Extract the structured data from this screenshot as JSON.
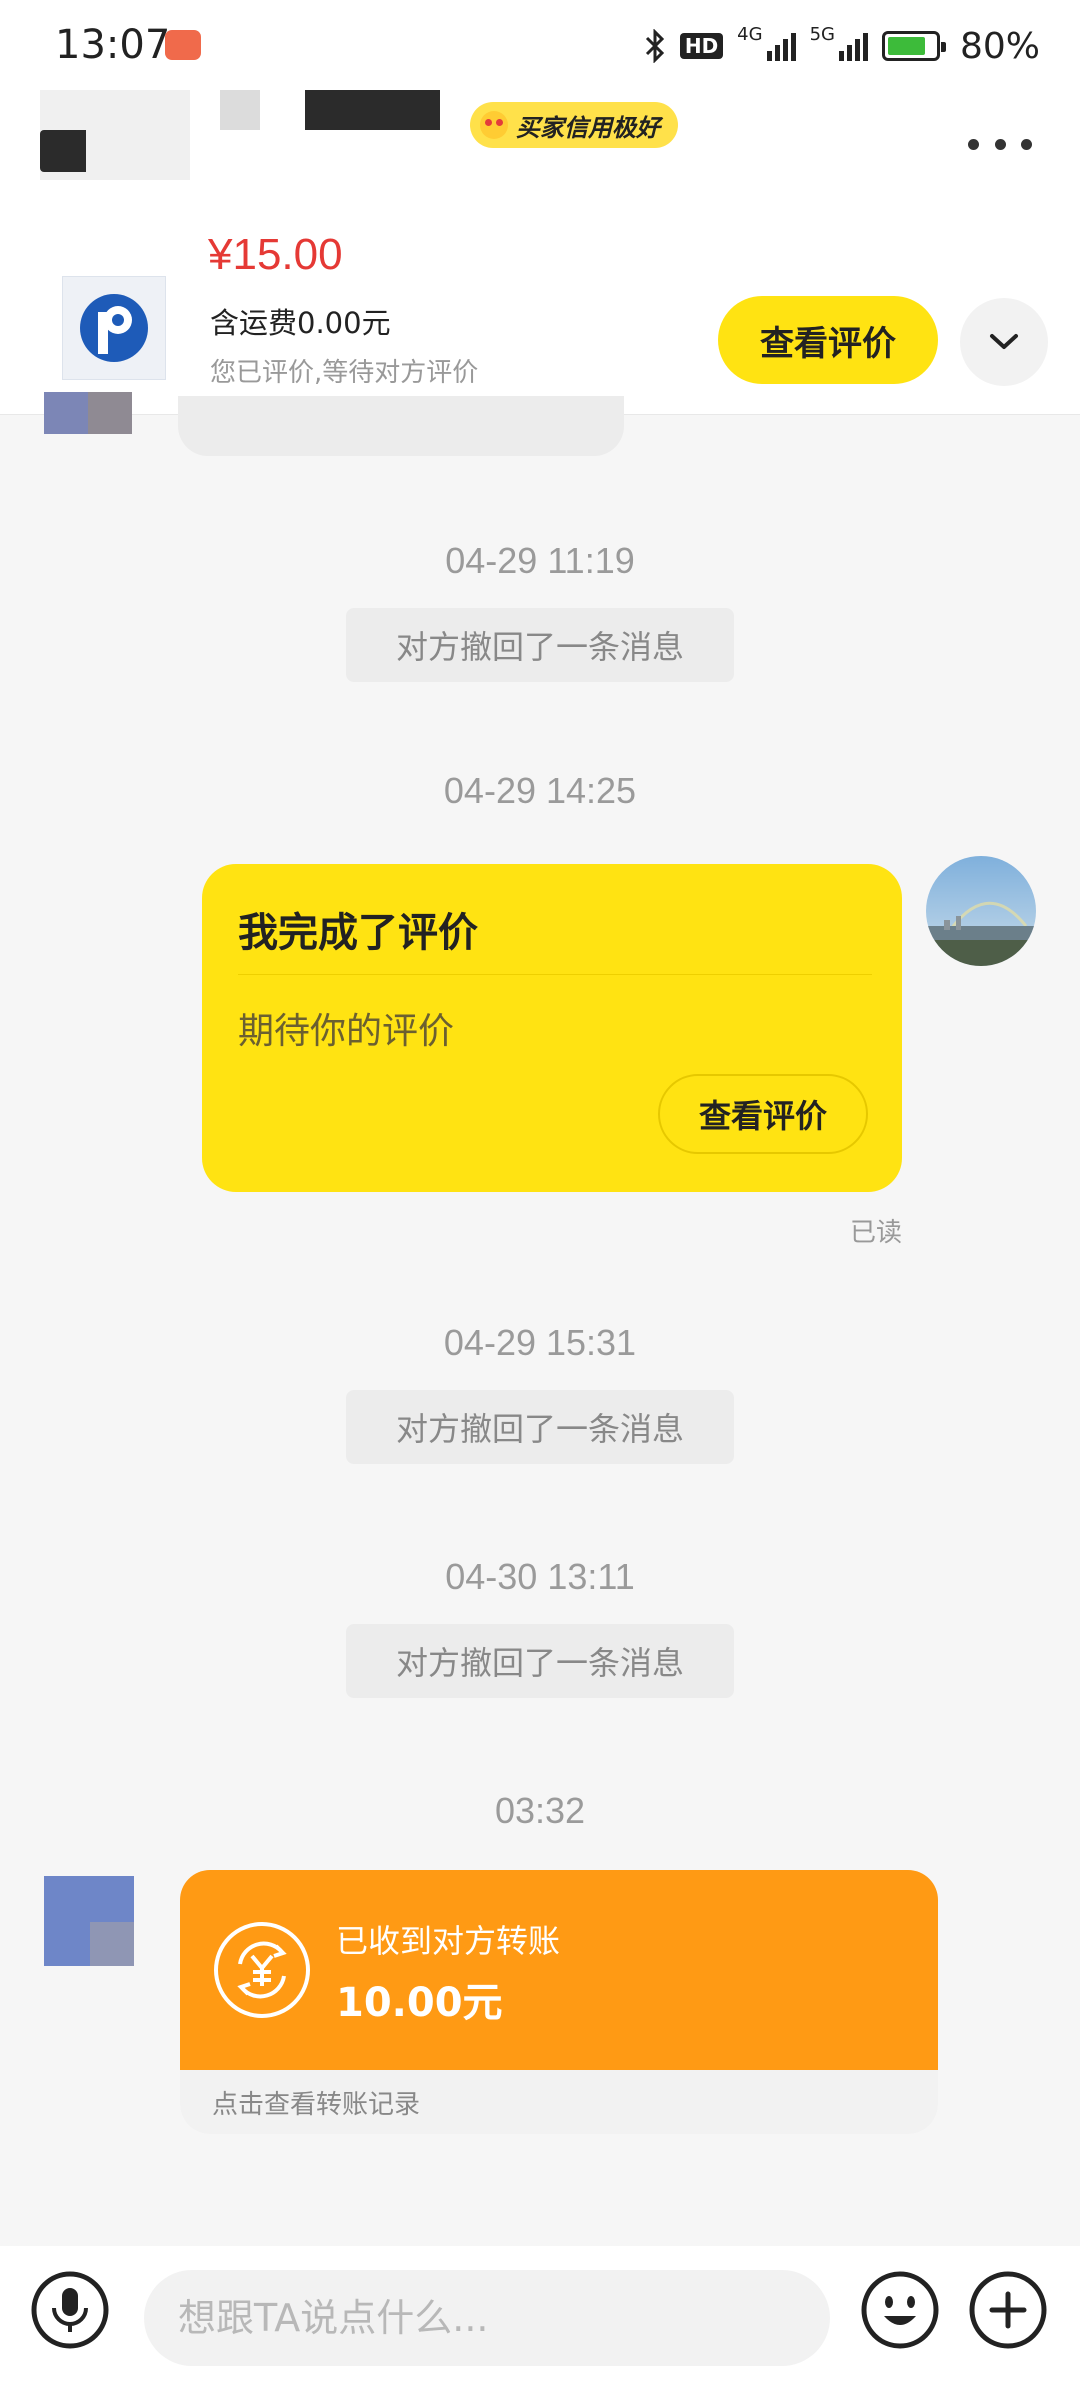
{
  "status_bar": {
    "time": "13:07",
    "hd_label": "HD",
    "net_label_1": "4G",
    "net_label_2": "5G",
    "battery_percent": "80%"
  },
  "header": {
    "credit_badge": "买家信用极好",
    "more_icon": "more-dots-icon"
  },
  "product": {
    "price": "¥15.00",
    "shipping": "含运费0.00元",
    "status": "您已评价,等待对方评价",
    "view_review_label": "查看评价",
    "expand_icon": "chevron-down-icon"
  },
  "chat": {
    "messages": [
      {
        "type": "timestamp",
        "text": "04-29 11:19"
      },
      {
        "type": "recall",
        "text": "对方撤回了一条消息"
      },
      {
        "type": "timestamp",
        "text": "04-29 14:25"
      },
      {
        "type": "review_card",
        "title": "我完成了评价",
        "body": "期待你的评价",
        "button": "查看评价",
        "read_receipt": "已读"
      },
      {
        "type": "timestamp",
        "text": "04-29 15:31"
      },
      {
        "type": "recall",
        "text": "对方撤回了一条消息"
      },
      {
        "type": "timestamp",
        "text": "04-30 13:11"
      },
      {
        "type": "recall",
        "text": "对方撤回了一条消息"
      },
      {
        "type": "timestamp",
        "text": "03:32"
      },
      {
        "type": "transfer",
        "label": "已收到对方转账",
        "amount": "10.00元",
        "link": "点击查看转账记录"
      }
    ]
  },
  "input_bar": {
    "placeholder": "想跟TA说点什么...",
    "voice_icon": "microphone-icon",
    "emoji_icon": "smiley-icon",
    "plus_icon": "plus-icon"
  },
  "colors": {
    "accent_yellow": "#ffe312",
    "price_red": "#e53935",
    "transfer_orange": "#ff9a14"
  }
}
